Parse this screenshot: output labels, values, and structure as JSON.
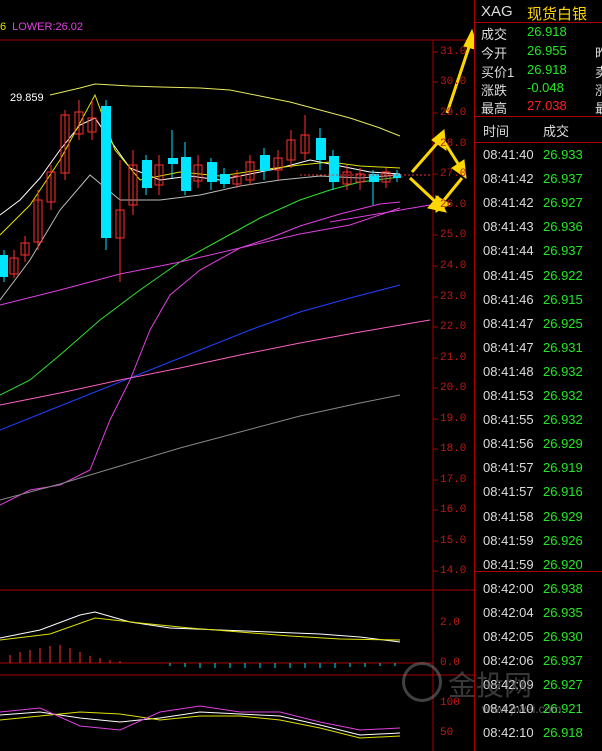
{
  "chart": {
    "legend_lead": "6",
    "legend_lower": "LOWER:26.02",
    "high_marker": "29.859",
    "price_axis": [
      "31.0",
      "30.0",
      "29.0",
      "28.0",
      "27.0",
      "26.0",
      "25.0",
      "24.0",
      "23.0",
      "22.0",
      "21.0",
      "20.0",
      "19.0",
      "18.0",
      "17.0",
      "16.0",
      "15.0",
      "14.0"
    ],
    "macd_axis": [
      "2.0",
      "0.0"
    ],
    "kdj_axis": [
      "100",
      "50"
    ]
  },
  "quote": {
    "symbol": "XAG",
    "name": "现货白银",
    "rows": [
      {
        "label": "成交",
        "value": "26.918",
        "color": "down",
        "extra": ""
      },
      {
        "label": "今开",
        "value": "26.955",
        "color": "down",
        "extra": "昨"
      },
      {
        "label": "买价1",
        "value": "26.918",
        "color": "down",
        "extra": "卖"
      },
      {
        "label": "涨跌",
        "value": "-0.048",
        "color": "down",
        "extra": "涨"
      },
      {
        "label": "最高",
        "value": "27.038",
        "color": "up",
        "extra": "最"
      }
    ]
  },
  "ticks": {
    "header_time": "时间",
    "header_price": "成交",
    "rows": [
      {
        "time": "08:41:40",
        "price": "26.933"
      },
      {
        "time": "08:41:42",
        "price": "26.937"
      },
      {
        "time": "08:41:42",
        "price": "26.927"
      },
      {
        "time": "08:41:43",
        "price": "26.936"
      },
      {
        "time": "08:41:44",
        "price": "26.937"
      },
      {
        "time": "08:41:45",
        "price": "26.922"
      },
      {
        "time": "08:41:46",
        "price": "26.915"
      },
      {
        "time": "08:41:47",
        "price": "26.925"
      },
      {
        "time": "08:41:47",
        "price": "26.931"
      },
      {
        "time": "08:41:48",
        "price": "26.932"
      },
      {
        "time": "08:41:53",
        "price": "26.932"
      },
      {
        "time": "08:41:55",
        "price": "26.932"
      },
      {
        "time": "08:41:56",
        "price": "26.929"
      },
      {
        "time": "08:41:57",
        "price": "26.919"
      },
      {
        "time": "08:41:57",
        "price": "26.916"
      },
      {
        "time": "08:41:58",
        "price": "26.929"
      },
      {
        "time": "08:41:59",
        "price": "26.926"
      },
      {
        "time": "08:41:59",
        "price": "26.920"
      },
      {
        "time": "08:42:00",
        "price": "26.938"
      },
      {
        "time": "08:42:04",
        "price": "26.935"
      },
      {
        "time": "08:42:05",
        "price": "26.930"
      },
      {
        "time": "08:42:06",
        "price": "26.937"
      },
      {
        "time": "08:42:09",
        "price": "26.927"
      },
      {
        "time": "08:42:10",
        "price": "26.921"
      },
      {
        "time": "08:42:10",
        "price": "26.918"
      }
    ]
  },
  "watermark": {
    "text": "金投网",
    "url": "www.jrwei.com"
  }
}
